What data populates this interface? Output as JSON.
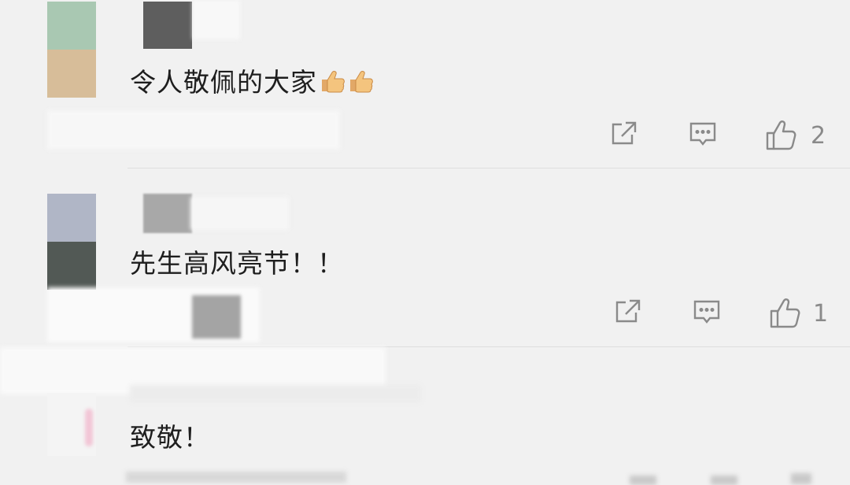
{
  "comments": [
    {
      "text": "令人敬佩的大家",
      "emoji_count": 2,
      "likes": "2",
      "avatar_colors": [
        "#a9c8b2",
        "#d7bd99"
      ]
    },
    {
      "text": "先生高风亮节！！",
      "emoji_count": 0,
      "likes": "1",
      "avatar_colors": [
        "#b0b6c6",
        "#525955"
      ]
    },
    {
      "text": "致敬！",
      "emoji_count": 0,
      "likes": "",
      "avatar_colors": [
        "#f4f4f4",
        "#efe6ea"
      ]
    }
  ],
  "icons": {
    "share": "share-icon",
    "reply": "comment-icon",
    "like": "thumbs-up-icon",
    "emoji": "thumbs-up-emoji"
  }
}
